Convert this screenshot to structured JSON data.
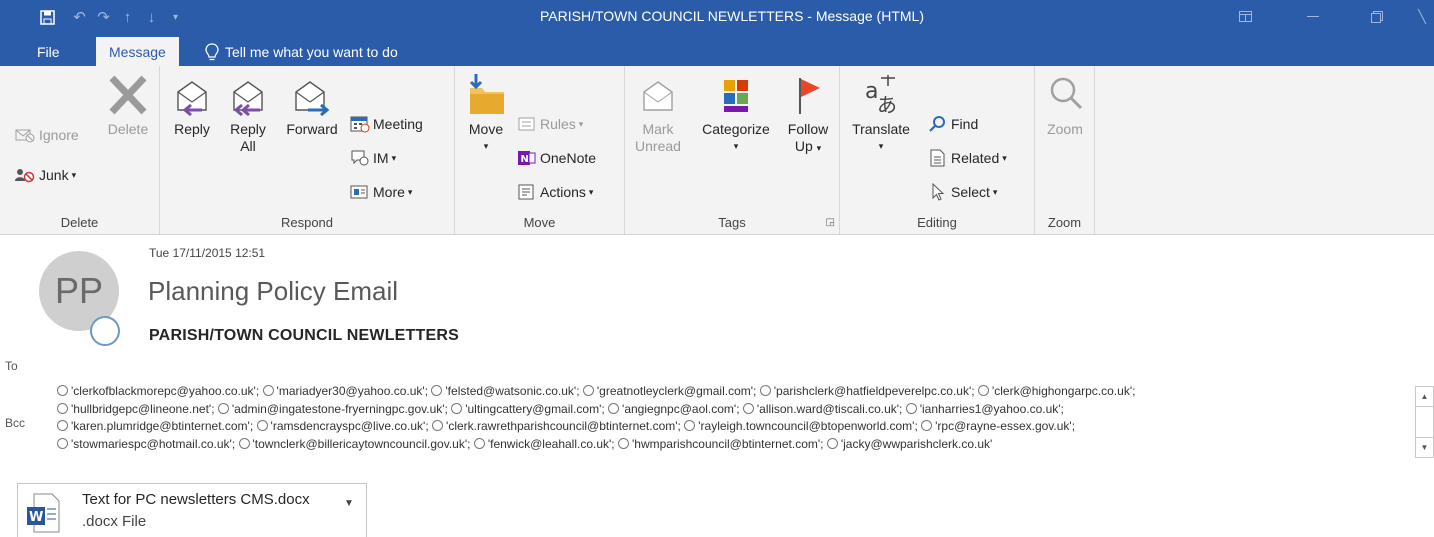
{
  "window": {
    "title": "PARISH/TOWN COUNCIL NEWLETTERS  -  Message (HTML)"
  },
  "tabs": {
    "file": "File",
    "message": "Message",
    "tell_me": "Tell me what you want to do"
  },
  "ribbon": {
    "delete_group": {
      "label": "Delete",
      "ignore": "Ignore",
      "junk": "Junk",
      "delete": "Delete"
    },
    "respond_group": {
      "label": "Respond",
      "reply": "Reply",
      "reply_all_1": "Reply",
      "reply_all_2": "All",
      "forward": "Forward",
      "meeting": "Meeting",
      "im": "IM",
      "more": "More"
    },
    "move_group": {
      "label": "Move",
      "move": "Move",
      "rules": "Rules",
      "onenote": "OneNote",
      "actions": "Actions"
    },
    "tags_group": {
      "label": "Tags",
      "mark_unread_1": "Mark",
      "mark_unread_2": "Unread",
      "categorize": "Categorize",
      "follow_up_1": "Follow",
      "follow_up_2": "Up"
    },
    "editing_group": {
      "label": "Editing",
      "translate": "Translate",
      "find": "Find",
      "related": "Related",
      "select": "Select"
    },
    "zoom_group": {
      "label": "Zoom",
      "zoom": "Zoom"
    }
  },
  "message": {
    "date": "Tue 17/11/2015 12:51",
    "avatar_initials": "PP",
    "sender": "Planning Policy Email",
    "subject": "PARISH/TOWN COUNCIL NEWLETTERS",
    "to_label": "To",
    "bcc_label": "Bcc",
    "bcc_rows": [
      [
        "'clerkofblackmorepc@yahoo.co.uk';",
        "'mariadyer30@yahoo.co.uk';",
        "'felsted@watsonic.co.uk';",
        "'greatnotleyclerk@gmail.com';",
        "'parishclerk@hatfieldpeverelpc.co.uk';",
        "'clerk@highongarpc.co.uk';"
      ],
      [
        "'hullbridgepc@lineone.net';",
        "'admin@ingatestone-fryerningpc.gov.uk';",
        "'ultingcattery@gmail.com';",
        "'angiegnpc@aol.com';",
        "'allison.ward@tiscali.co.uk';",
        "'ianharries1@yahoo.co.uk';"
      ],
      [
        "'karen.plumridge@btinternet.com';",
        "'ramsdencrayspc@live.co.uk';",
        "'clerk.rawrethparishcouncil@btinternet.com';",
        "'rayleigh.towncouncil@btopenworld.com';",
        "'rpc@rayne-essex.gov.uk';"
      ],
      [
        "'stowmariespc@hotmail.co.uk';",
        "'townclerk@billericaytowncouncil.gov.uk';",
        "'fenwick@leahall.co.uk';",
        "'hwmparishcouncil@btinternet.com';",
        "'jacky@wwparishclerk.co.uk'"
      ]
    ],
    "attachment": {
      "name": "Text for PC newsletters CMS.docx",
      "type": ".docx File"
    }
  }
}
